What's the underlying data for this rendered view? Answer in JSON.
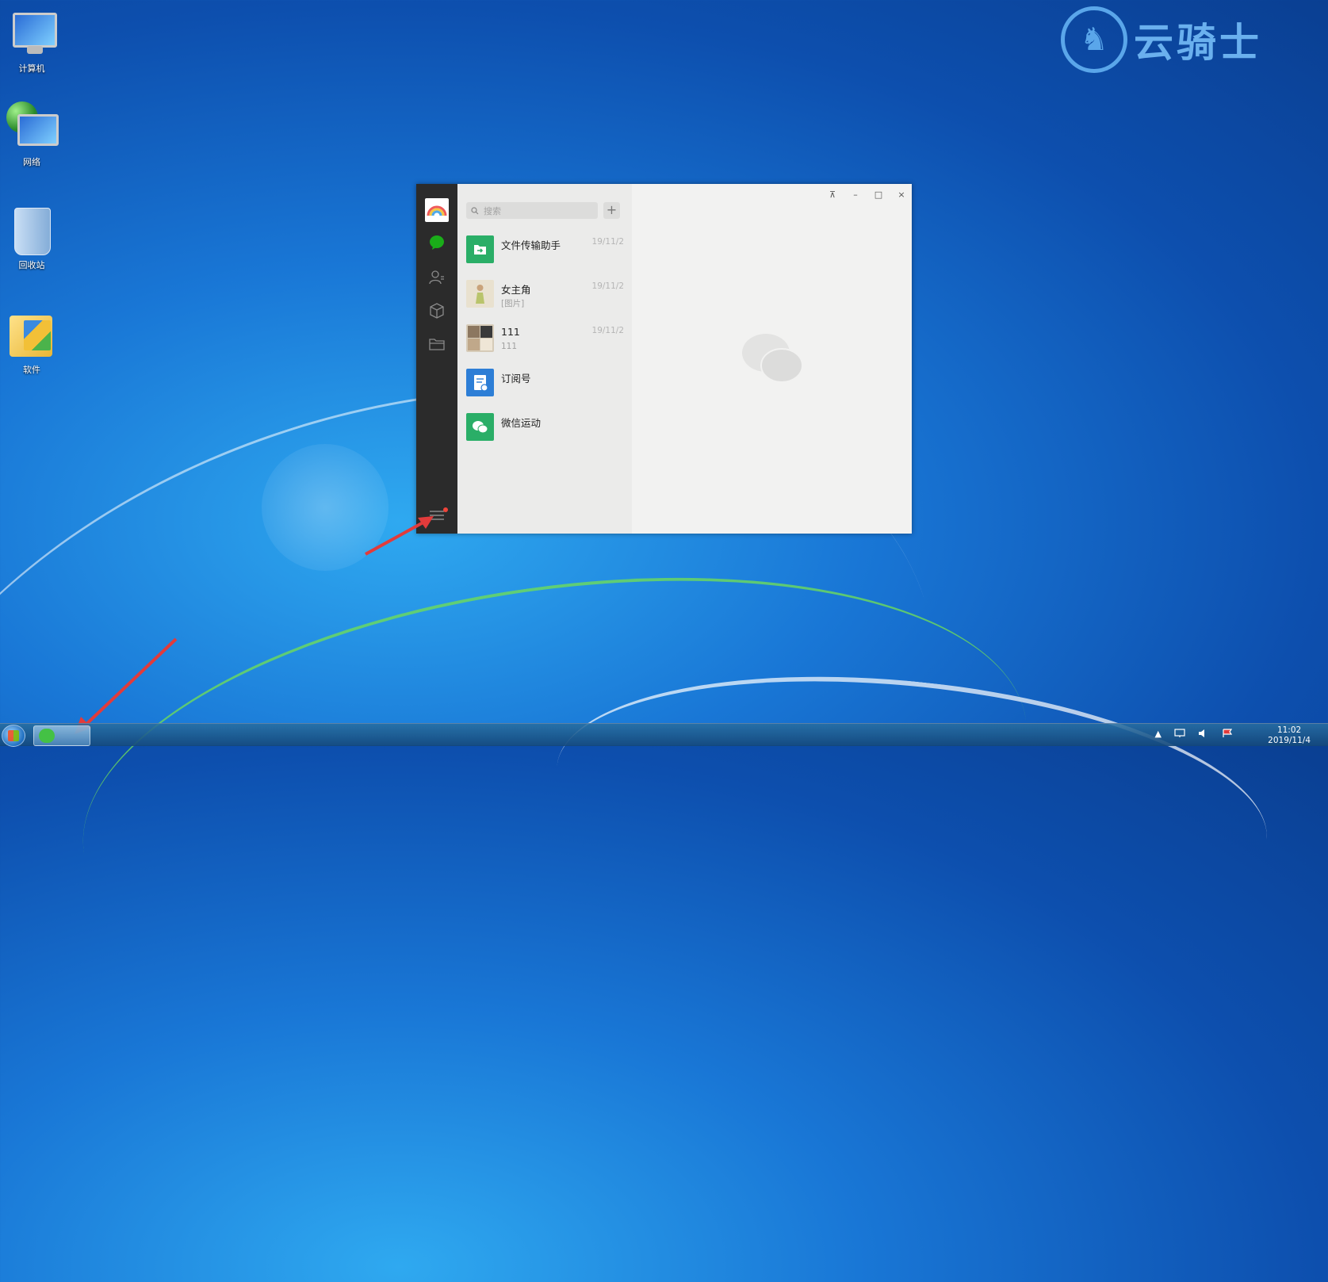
{
  "desktop": {
    "icons": [
      {
        "label": "计算机",
        "icon": "computer-icon"
      },
      {
        "label": "网络",
        "icon": "network-icon"
      },
      {
        "label": "回收站",
        "icon": "recycle-bin-icon"
      },
      {
        "label": "软件",
        "icon": "folder-icon"
      }
    ],
    "watermark": "云骑士"
  },
  "wechat": {
    "search_placeholder": "搜索",
    "add_label": "+",
    "chats": [
      {
        "name": "文件传输助手",
        "preview": "",
        "date": "19/11/2",
        "avatar": "file-transfer-icon",
        "color": "#2aae67"
      },
      {
        "name": "女主角",
        "preview": "[图片]",
        "date": "19/11/2",
        "avatar": "avatar-photo",
        "color": "#e9e1cf"
      },
      {
        "name": "111",
        "preview": "111",
        "date": "19/11/2",
        "avatar": "avatar-photo",
        "color": "#d6cbb8"
      },
      {
        "name": "订阅号",
        "preview": "",
        "date": "",
        "avatar": "subscription-icon",
        "color": "#2d7ed6"
      },
      {
        "name": "微信运动",
        "preview": "",
        "date": "",
        "avatar": "wechat-sport-icon",
        "color": "#2aae67"
      }
    ],
    "window_buttons": {
      "pin": "⊼",
      "minimize": "–",
      "maximize": "□",
      "close": "×"
    }
  },
  "taskbar": {
    "clock_time": "11:02",
    "clock_date": "2019/11/4",
    "tray_up": "▲"
  }
}
